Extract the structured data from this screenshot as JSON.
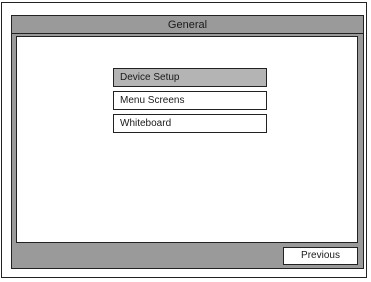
{
  "window": {
    "title": "General"
  },
  "menu": {
    "items": [
      {
        "label": "Device Setup",
        "selected": true
      },
      {
        "label": "Menu Screens",
        "selected": false
      },
      {
        "label": "Whiteboard",
        "selected": false
      }
    ]
  },
  "footer": {
    "previous_label": "Previous"
  },
  "colors": {
    "panel_gray": "#9a9a9a",
    "selected_gray": "#b4b4b4",
    "background": "#ffffff",
    "border": "#222222"
  }
}
